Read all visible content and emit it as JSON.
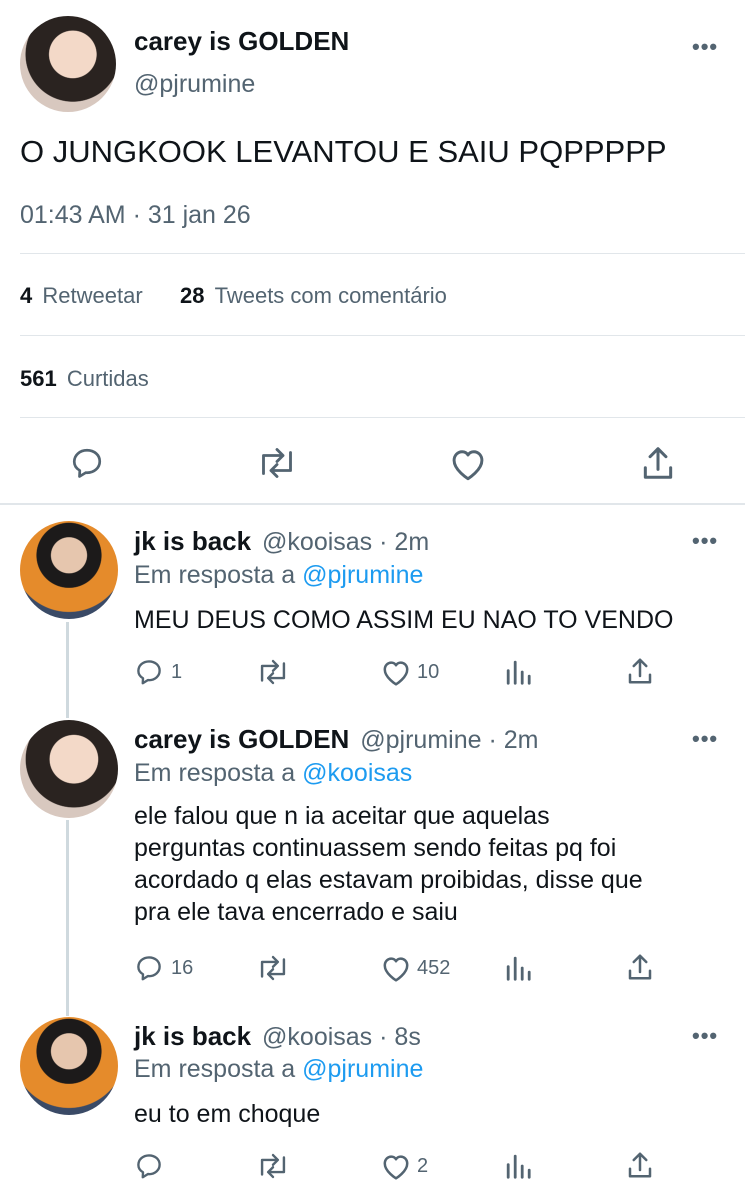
{
  "main_tweet": {
    "display_name": "carey is GOLDEN",
    "handle": "@pjrumine",
    "text": "O JUNGKOOK LEVANTOU E SAIU PQPPPPP",
    "timestamp": "01:43 AM · 31 jan 26",
    "retweets_count": "4",
    "retweets_label": "Retweetar",
    "quotes_count": "28",
    "quotes_label": "Tweets com comentário",
    "likes_count": "561",
    "likes_label": "Curtidas"
  },
  "replies": [
    {
      "display_name": "jk is back",
      "handle": "@kooisas",
      "time": "· 2m",
      "reply_prefix": "Em resposta a",
      "reply_to": "@pjrumine",
      "text_lines": [
        "MEU DEUS COMO ASSIM EU NAO TO VENDO"
      ],
      "reply_count": "1",
      "like_count": "10"
    },
    {
      "display_name": "carey is GOLDEN",
      "handle": "@pjrumine",
      "time": "· 2m",
      "reply_prefix": "Em resposta a",
      "reply_to": "@kooisas",
      "text_lines": [
        "ele falou que n ia aceitar que aquelas",
        "perguntas continuassem sendo feitas pq foi",
        "acordado q elas estavam proibidas, disse que",
        "pra ele tava encerrado e saiu"
      ],
      "reply_count": "16",
      "like_count": "452"
    },
    {
      "display_name": "jk is back",
      "handle": "@kooisas",
      "time": "· 8s",
      "reply_prefix": "Em resposta a",
      "reply_to": "@pjrumine",
      "text_lines": [
        "eu to em choque"
      ],
      "reply_count": "",
      "like_count": "2"
    }
  ],
  "more_glyph": "•••",
  "colors": {
    "accent": "#1d9bf0",
    "muted": "#536471",
    "divider": "#e1e6ea"
  }
}
